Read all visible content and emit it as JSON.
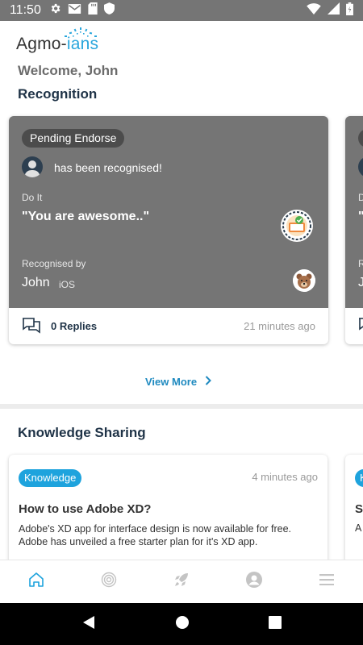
{
  "status_bar": {
    "time": "11:50",
    "left_icons": [
      "gear-icon",
      "mail-icon",
      "sd-card-icon",
      "shield-icon"
    ],
    "right_icons": [
      "wifi-icon",
      "signal-icon",
      "battery-icon"
    ]
  },
  "header": {
    "logo_main": "Agmo-",
    "logo_accent": "ians",
    "welcome": "Welcome, John"
  },
  "recognition": {
    "title": "Recognition",
    "card": {
      "status": "Pending Endorse",
      "recognised_text": "has been recognised!",
      "value_label": "Do It",
      "quote": "\"You are awesome..\"",
      "recognised_by_label": "Recognised by",
      "recognised_by_name": "John",
      "platform": "iOS",
      "replies": "0 Replies",
      "time_ago": "21 minutes ago"
    },
    "peek_card": {
      "value_label_fragment": "D",
      "quote_fragment": "\"",
      "label_fragment": "R",
      "name_fragment": "J"
    },
    "view_more": "View More"
  },
  "knowledge": {
    "title": "Knowledge Sharing",
    "card": {
      "tag": "Knowledge",
      "time_ago": "4 minutes ago",
      "title": "How to use Adobe XD?",
      "body": "Adobe's XD app for interface design is now available for free. Adobe has unveiled a free starter plan for it's XD app."
    },
    "peek_card": {
      "tag_fragment": "K",
      "title_fragment": "S",
      "body_fragment": "A"
    }
  },
  "bottom_nav": [
    "home-icon",
    "target-icon",
    "rocket-icon",
    "profile-icon",
    "menu-icon"
  ],
  "colors": {
    "accent": "#1ea3dd",
    "card_gray": "#757575",
    "title_navy": "#1f3347"
  }
}
